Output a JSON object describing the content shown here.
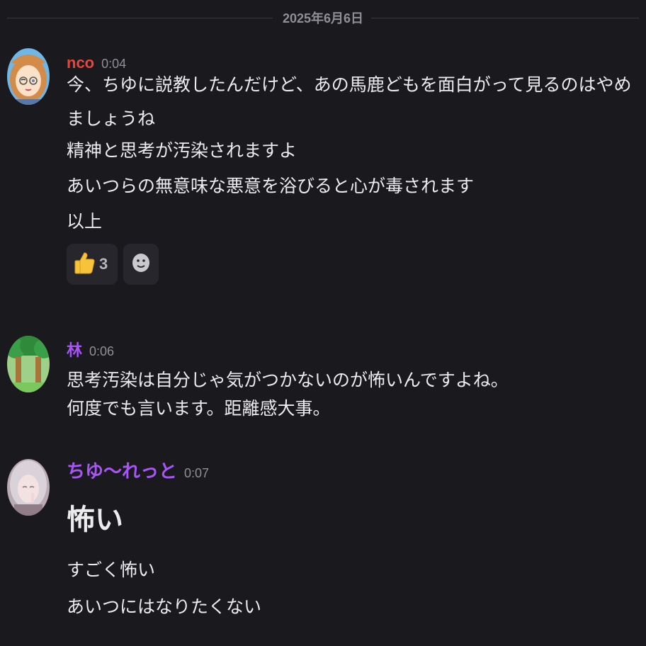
{
  "date_divider": "2025年6月6日",
  "messages": [
    {
      "author": "nco",
      "author_color": "#e8453c",
      "time": "0:04",
      "lines": [
        "今、ちゆに説教したんだけど、あの馬鹿どもを面白がって見るのはやめましょうね",
        "精神と思考が汚染されますよ",
        "あいつらの無意味な悪意を浴びると心が毒されます",
        "以上"
      ],
      "reactions": [
        {
          "emoji": "👍",
          "icon": "thumbs-up-icon",
          "count": "3"
        }
      ],
      "add_reaction_icon": "add-reaction-smiley-icon"
    },
    {
      "author": "林",
      "author_color": "#a855f7",
      "time": "0:06",
      "lines": [
        "思考汚染は自分じゃ気がつかないのが怖いんですよね。",
        "何度でも言います。距離感大事。"
      ]
    },
    {
      "author": "ちゆ〜れっと",
      "author_color": "#a855f7",
      "time": "0:07",
      "heading": "怖い",
      "lines": [
        "すごく怖い",
        "あいつにはなりたくない"
      ]
    }
  ],
  "colors": {
    "background": "#1a1a1e",
    "text": "#ececee",
    "muted": "#8f8f96",
    "reaction_bg": "#26262c"
  }
}
